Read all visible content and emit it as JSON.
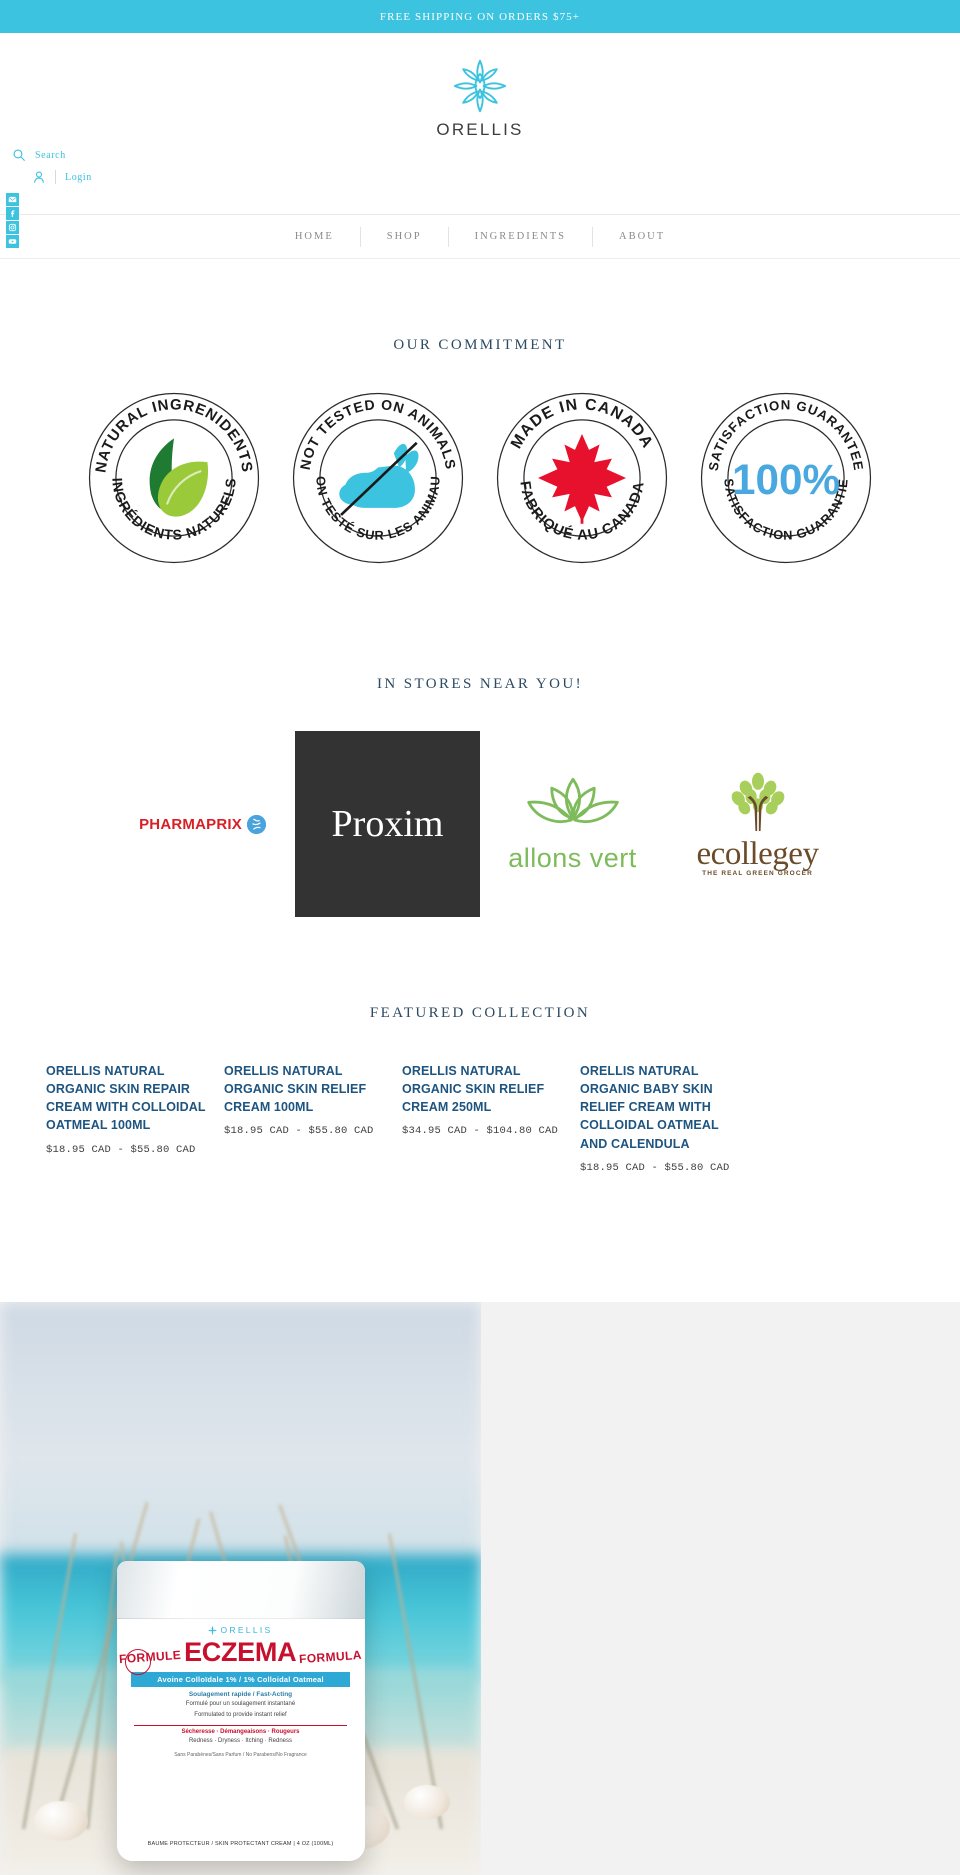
{
  "announcement": {
    "text": "FREE SHIPPING ON ORDERS $75+"
  },
  "brand": {
    "name": "ORELLIS",
    "accent_color": "#3cc3e0"
  },
  "utility": {
    "search_label": "Search",
    "login_label": "Login",
    "search_icon": "search-icon",
    "account_icon": "user-icon"
  },
  "social": [
    {
      "name": "email-icon",
      "label": "Email"
    },
    {
      "name": "facebook-icon",
      "label": "Facebook"
    },
    {
      "name": "instagram-icon",
      "label": "Instagram"
    },
    {
      "name": "youtube-icon",
      "label": "YouTube"
    }
  ],
  "nav": {
    "items": [
      {
        "label": "HOME"
      },
      {
        "label": "SHOP"
      },
      {
        "label": "INGREDIENTS"
      },
      {
        "label": "ABOUT"
      }
    ]
  },
  "commitment": {
    "title": "OUR COMMITMENT",
    "badges": [
      {
        "icon": "leaf-icon",
        "top_text": "NATURAL INGRENIDENTS",
        "bottom_text": "INGRÉDIENTS NATURELS",
        "color": "#2f7d32"
      },
      {
        "icon": "rabbit-crossed-icon",
        "top_text": "NOT TESTED ON ANIMALS",
        "bottom_text": "NON TESTÉ SUR LES ANIMAUX",
        "color": "#3cc3e0"
      },
      {
        "icon": "maple-leaf-icon",
        "top_text": "MADE IN CANADA",
        "bottom_text": "FABRIQUÉ AU CANADA",
        "color": "#e8112d"
      },
      {
        "icon": "percent-100-icon",
        "top_text": "SATISFACTION GUARANTEE",
        "bottom_text": "SATISFACTION GUARANTIE",
        "center_text": "100%",
        "color": "#4aa8e0"
      }
    ]
  },
  "stores": {
    "title": "IN STORES NEAR YOU!",
    "logos": [
      {
        "name": "pharmaprix-logo",
        "text": "PHARMAPRIX",
        "color": "#d81f26"
      },
      {
        "name": "proxim-logo",
        "text": "Proxim",
        "background": "#333333",
        "color": "#ffffff"
      },
      {
        "name": "allons-vert-logo",
        "text": "allons vert",
        "color": "#7dbb5b"
      },
      {
        "name": "ecollegey-logo",
        "text": "ecollegey",
        "tagline": "THE REAL GREEN GROCER",
        "color": "#6b4b29"
      }
    ]
  },
  "featured": {
    "title": "FEATURED COLLECTION",
    "products": [
      {
        "title": "ORELLIS NATURAL ORGANIC SKIN REPAIR CREAM WITH COLLOIDAL OATMEAL 100ML",
        "price": "$18.95 CAD - $55.80 CAD"
      },
      {
        "title": "ORELLIS NATURAL ORGANIC SKIN RELIEF CREAM 100ML",
        "price": "$18.95 CAD - $55.80 CAD"
      },
      {
        "title": "ORELLIS NATURAL ORGANIC SKIN RELIEF CREAM 250ML",
        "price": "$34.95 CAD - $104.80 CAD"
      },
      {
        "title": "ORELLIS NATURAL ORGANIC BABY SKIN RELIEF CREAM WITH COLLOIDAL OATMEAL AND CALENDULA",
        "price": "$18.95 CAD - $55.80 CAD"
      }
    ]
  },
  "hero": {
    "product_label": {
      "brand": "ORELLIS",
      "formule": "FORMULE",
      "main": "ECZEMA",
      "formula_right": "FORMULA",
      "strip": "Avoine Colloïdale 1% / 1% Colloidal Oatmeal",
      "fast_acting": "Soulagement rapide / Fast-Acting",
      "line1": "Formulé pour un soulagement instantané",
      "line2": "Formulated to provide instant relief",
      "symptoms": "Sécheresse · Démangeaisons · Rougeurs",
      "symptoms_en": "Redness · Dryness · Itching · Redness",
      "bottom": "BAUME PROTECTEUR / SKIN PROTECTANT CREAM | 4 OZ (100ML)",
      "ingredient_note": "Sans Parabènes/Sans Parfum / No Parabens/No Fragrance"
    }
  }
}
